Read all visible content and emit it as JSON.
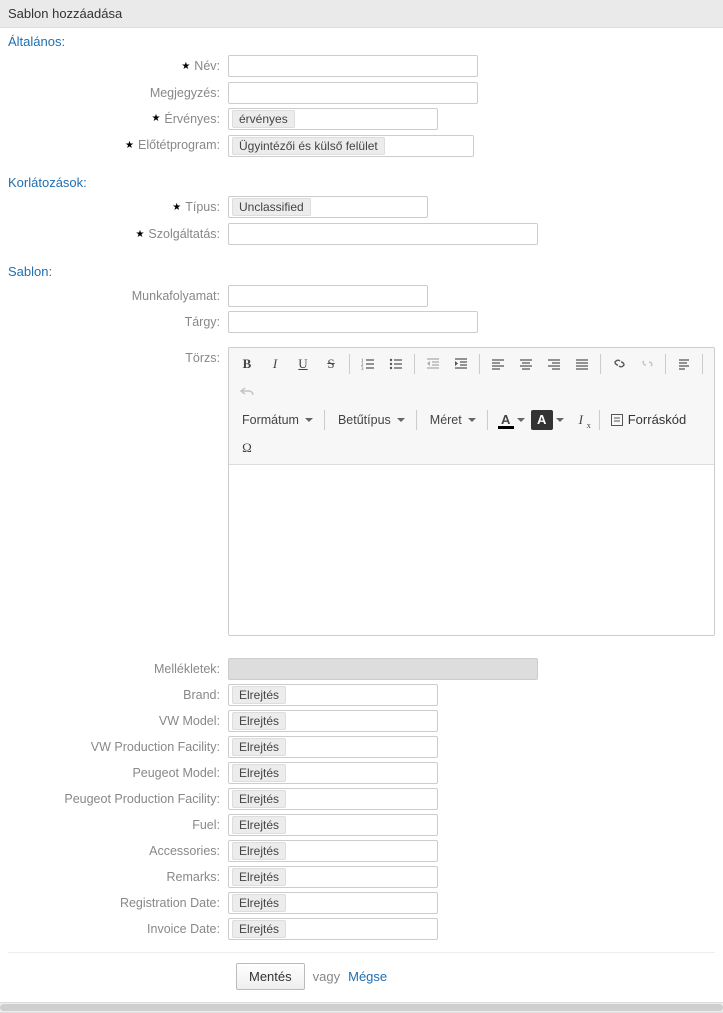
{
  "header": {
    "title": "Sablon hozzáadása"
  },
  "sections": {
    "general": "Általános:",
    "restrictions": "Korlátozások:",
    "template": "Sablon:"
  },
  "labels": {
    "name": "Név:",
    "comment": "Megjegyzés:",
    "valid": "Érvényes:",
    "frontend": "Előtétprogram:",
    "type": "Típus:",
    "service": "Szolgáltatás:",
    "workflow": "Munkafolyamat:",
    "subject": "Tárgy:",
    "body": "Törzs:",
    "attachments": "Mellékletek:",
    "brand": "Brand:",
    "vwModel": "VW Model:",
    "vwFacility": "VW Production Facility:",
    "peugeotModel": "Peugeot Model:",
    "peugeotFacility": "Peugeot Production Facility:",
    "fuel": "Fuel:",
    "accessories": "Accessories:",
    "remarks": "Remarks:",
    "regDate": "Registration Date:",
    "invDate": "Invoice Date:"
  },
  "values": {
    "valid": "érvényes",
    "frontend": "Ügyintézői és külső felület",
    "type": "Unclassified",
    "hide": "Elrejtés"
  },
  "toolbar": {
    "format": "Formátum",
    "font": "Betűtípus",
    "size": "Méret",
    "source": "Forráskód"
  },
  "footer": {
    "save": "Mentés",
    "or": "vagy",
    "cancel": "Mégse"
  }
}
